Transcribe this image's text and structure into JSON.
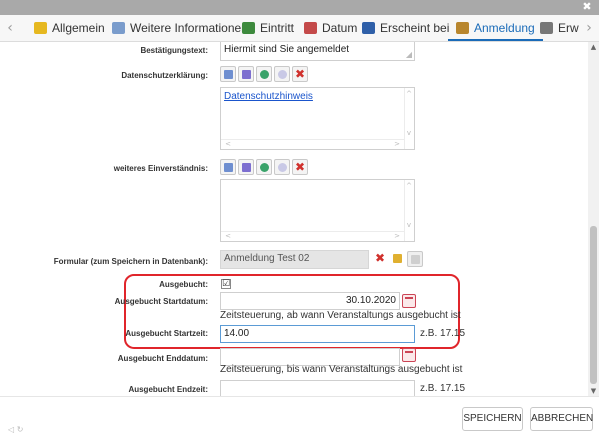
{
  "window": {
    "close_glyph": "✖"
  },
  "tabs": [
    {
      "label": "Allgemein",
      "icon": "folder-icon",
      "color": "#e6b820"
    },
    {
      "label": "Weitere Informationen",
      "icon": "document-icon",
      "color": "#7a9ccc"
    },
    {
      "label": "Eintritt",
      "icon": "people-icon",
      "color": "#3d8a3d"
    },
    {
      "label": "Datum",
      "icon": "calendar-icon",
      "color": "#c44a4a"
    },
    {
      "label": "Erscheint bei",
      "icon": "chart-icon",
      "color": "#2f5fa8"
    },
    {
      "label": "Anmeldung",
      "icon": "group-icon",
      "color": "#b8862e",
      "active": true
    },
    {
      "label": "Erwe",
      "icon": "pencil-icon",
      "color": "#777777"
    }
  ],
  "form": {
    "bestaetigungstext": {
      "label": "Bestätigungstext:",
      "value": "Hiermit sind Sie angemeldet"
    },
    "datenschutz": {
      "label": "Datenschutzerklärung:",
      "link": "Datenschutzhinweis"
    },
    "einverstaendnis": {
      "label": "weiteres Einverständnis:"
    },
    "formular": {
      "label": "Formular (zum Speichern in Datenbank):",
      "value": "Anmeldung Test 02"
    },
    "ausgebucht": {
      "label": "Ausgebucht:",
      "checked": "☑"
    },
    "start_datum": {
      "label": "Ausgebucht Startdatum:",
      "value": "30.10.2020",
      "hint": "Zeitsteuerung, ab wann Veranstaltungs ausgebucht ist"
    },
    "start_zeit": {
      "label": "Ausgebucht Startzeit:",
      "value": "14.00",
      "hint": "z.B. 17.15"
    },
    "end_datum": {
      "label": "Ausgebucht Enddatum:",
      "value": "",
      "hint": "Zeitsteuerung, bis wann Veranstaltungs ausgebucht ist"
    },
    "end_zeit": {
      "label": "Ausgebucht Endzeit:",
      "value": "",
      "hint": "z.B. 17.15"
    }
  },
  "buttons": {
    "save": "SPEICHERN",
    "cancel": "ABBRECHEN"
  },
  "colors": {
    "accent": "#1a6bb8",
    "highlight": "#e0252b"
  }
}
